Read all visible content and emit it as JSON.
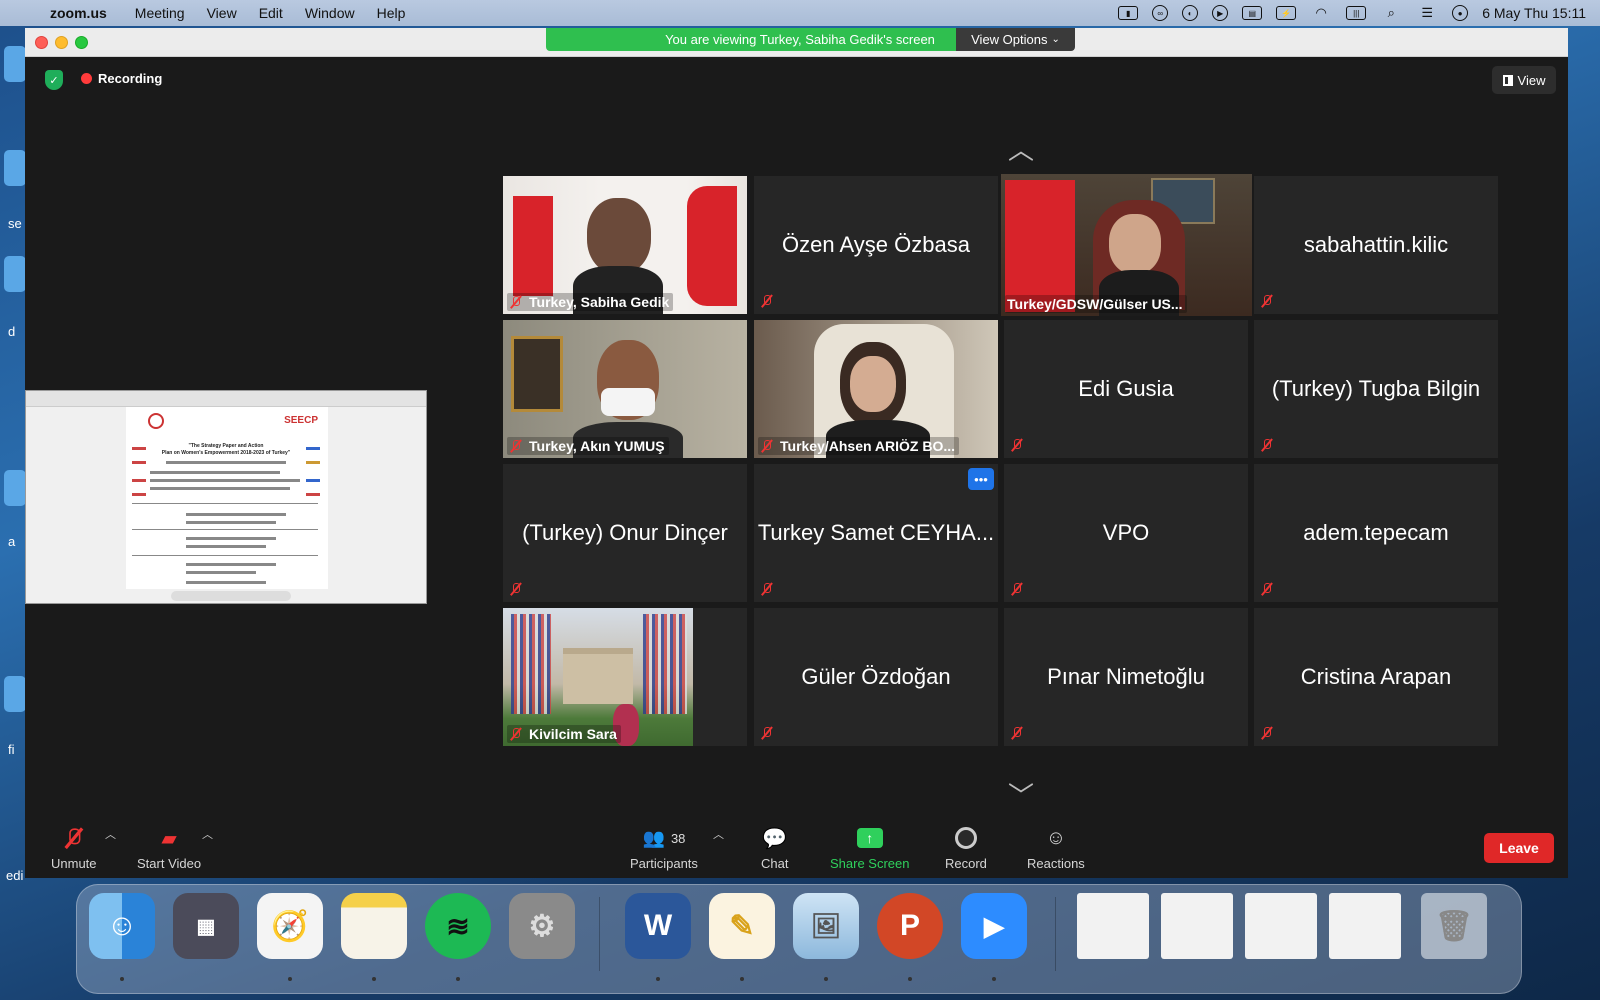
{
  "menubar": {
    "app": "zoom.us",
    "items": [
      "Meeting",
      "View",
      "Edit",
      "Window",
      "Help"
    ],
    "datetime": "6 May Thu  15:11"
  },
  "desktop_labels": [
    "se",
    "d",
    "a",
    "fi",
    "edi"
  ],
  "window": {
    "banner": "You are viewing Turkey, Sabiha Gedik's screen",
    "view_options": "View Options",
    "recording": "Recording",
    "view": "View"
  },
  "participants": [
    {
      "name": "Turkey, Sabiha Gedik",
      "video": true
    },
    {
      "name": "Özen Ayşe Özbasa",
      "video": false
    },
    {
      "name": "Turkey/GDSW/Gülser US...",
      "video": true,
      "active": true
    },
    {
      "name": "sabahattin.kilic",
      "video": false
    },
    {
      "name": "Turkey, Akın YUMUŞ",
      "video": true
    },
    {
      "name": "Turkey/Ahsen ARIÖZ BO...",
      "video": true
    },
    {
      "name": "Edi Gusia",
      "video": false
    },
    {
      "name": "(Turkey) Tugba Bilgin",
      "video": false
    },
    {
      "name": "(Turkey) Onur Dinçer",
      "video": false
    },
    {
      "name": "Turkey Samet CEYHA...",
      "video": false
    },
    {
      "name": "VPO",
      "video": false
    },
    {
      "name": "adem.tepecam",
      "video": false
    },
    {
      "name": "Kivilcim Sara",
      "video": true
    },
    {
      "name": "Güler Özdoğan",
      "video": false
    },
    {
      "name": "Pınar Nimetoğlu",
      "video": false
    },
    {
      "name": "Cristina Arapan",
      "video": false
    }
  ],
  "toolbar": {
    "unmute": "Unmute",
    "start_video": "Start Video",
    "participants": "Participants",
    "participant_count": "38",
    "chat": "Chat",
    "share_screen": "Share Screen",
    "record": "Record",
    "reactions": "Reactions",
    "leave": "Leave"
  },
  "shared_doc": {
    "logo_text": "SEECP",
    "title_line1": "\"The Strategy Paper and Action",
    "title_line2": "Plan on Women's Empowerment 2018-2023 of Turkey\""
  },
  "dock": {
    "word_letter": "W",
    "ppt_letter": "P"
  },
  "colors": {
    "banner": "#2fbf4f",
    "leave": "#e02828",
    "share": "#2fd05c",
    "active_speaker": "#e7e77a"
  }
}
